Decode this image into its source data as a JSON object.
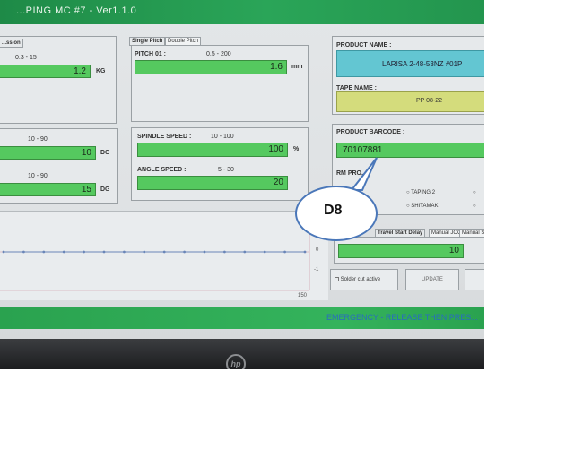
{
  "window": {
    "title": "...PING MC #7 - Ver1.1.0"
  },
  "left_panel": {
    "tab_fragment": "...ssion",
    "tension_range": "0.3 - 15",
    "tension_value": "1.2",
    "tension_unit": "KG",
    "angle_a_range": "10 - 90",
    "angle_a_value": "10",
    "angle_a_unit": "DG",
    "angle_b_range": "10 - 90",
    "angle_b_value": "15",
    "angle_b_unit": "DG"
  },
  "pitch_panel": {
    "tabs": [
      "Single Pitch",
      "Double Pitch"
    ],
    "pitch_label": "PITCH 01 :",
    "pitch_range": "0.5 - 200",
    "pitch_value": "1.6",
    "pitch_unit": "mm"
  },
  "speed_panel": {
    "spindle_label": "SPINDLE SPEED :",
    "spindle_range": "10 - 100",
    "spindle_value": "100",
    "spindle_unit": "%",
    "angle_label": "ANGLE SPEED :",
    "angle_range": "5 - 30",
    "angle_value": "20"
  },
  "product": {
    "name_label": "PRODUCT NAME :",
    "name_value": "LARISA 2-48-53NZ #01P",
    "tape_label": "TAPE NAME :",
    "tape_value": "PP 08-22",
    "barcode_label": "PRODUCT BARCODE :",
    "barcode_value": "70107881",
    "program_label": "RM PRO...",
    "options": [
      "TAPING 2",
      "SHITAMAKI"
    ]
  },
  "delay": {
    "tabs": [
      "Travel Start Delay",
      "Manual JOG",
      "Manual S..."
    ],
    "value": "10"
  },
  "controls": {
    "solder_checkbox": "Solder cut active",
    "update_button": "UPDATE"
  },
  "chart": {
    "y_top": "0",
    "y_bottom": "-1",
    "x_end": "150"
  },
  "status": {
    "message": "EMERGENCY - RELEASE THEN PRES..."
  },
  "device": {
    "logo": "hp"
  },
  "annotation": {
    "label": "D8"
  },
  "chart_data": {
    "type": "line",
    "x": [
      0,
      10,
      20,
      30,
      40,
      50,
      60,
      70,
      80,
      90,
      100,
      110,
      120,
      130,
      140,
      150
    ],
    "series": [
      {
        "values": [
          0,
          0,
          0,
          0,
          0,
          0,
          0,
          0,
          0,
          0,
          0,
          0,
          0,
          0,
          0,
          0
        ]
      }
    ],
    "xlim": [
      0,
      150
    ],
    "ylim": [
      -1,
      0
    ],
    "colors": {
      "line": "#6a86b8",
      "marker": "#6a86b8"
    }
  }
}
